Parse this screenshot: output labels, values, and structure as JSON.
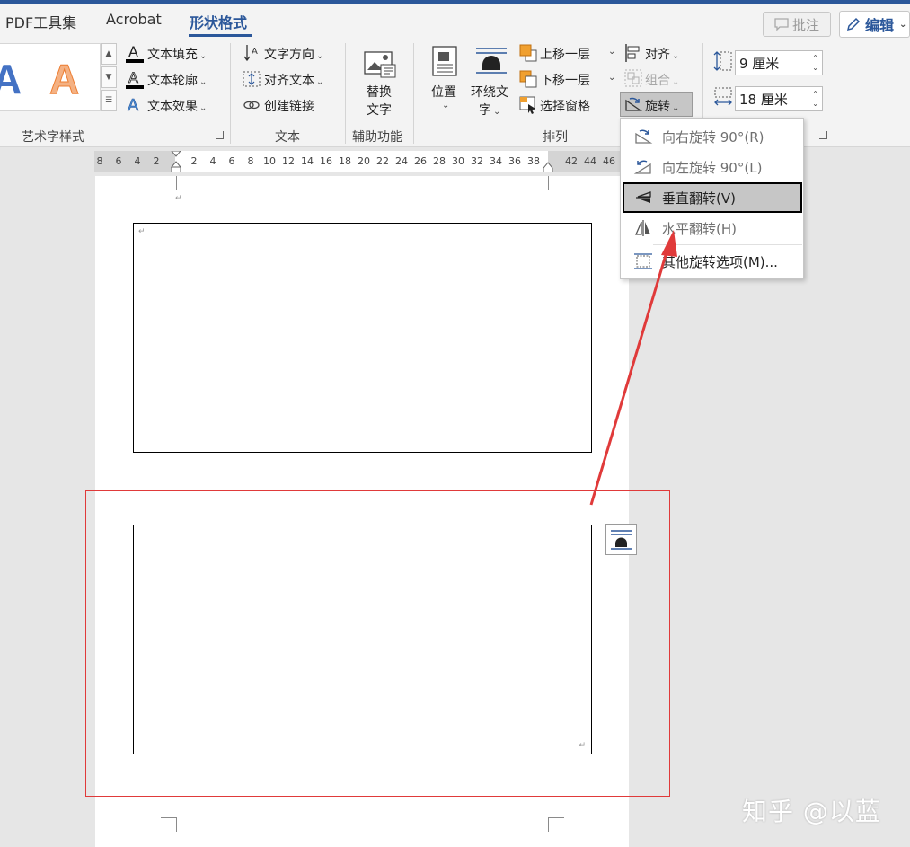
{
  "tabs": [
    {
      "label": "PDF工具集"
    },
    {
      "label": "Acrobat"
    },
    {
      "label": "形状格式",
      "active": true
    }
  ],
  "top_right": {
    "comment_label": "批注",
    "edit_label": "编辑"
  },
  "ribbon": {
    "wordart": {
      "samples": [
        "A",
        "A"
      ],
      "text_fill": "文本填充",
      "text_outline": "文本轮廓",
      "text_effects": "文本效果",
      "group_label": "艺术字样式"
    },
    "text": {
      "text_direction": "文字方向",
      "align_text": "对齐文本",
      "create_link": "创建链接",
      "group_label": "文本"
    },
    "accessibility": {
      "alt_text_line1": "替换",
      "alt_text_line2": "文字",
      "group_label": "辅助功能"
    },
    "arrange": {
      "position": "位置",
      "wrap_text_line1": "环绕文",
      "wrap_text_line2": "字",
      "bring_forward": "上移一层",
      "send_backward": "下移一层",
      "selection_pane": "选择窗格",
      "align": "对齐",
      "group": "组合",
      "rotate": "旋转",
      "group_label": "排列"
    },
    "size": {
      "height_value": "9 厘米",
      "width_value": "18 厘米"
    }
  },
  "ruler": {
    "left_numbers": [
      "8",
      "6",
      "4",
      "2"
    ],
    "numbers": [
      "2",
      "4",
      "6",
      "8",
      "10",
      "12",
      "14",
      "16",
      "18",
      "20",
      "22",
      "24",
      "26",
      "28",
      "30",
      "32",
      "34",
      "36",
      "38"
    ],
    "right_numbers": [
      "42",
      "44",
      "46"
    ]
  },
  "rotate_menu": {
    "items": [
      {
        "label": "向右旋转 90°(R)",
        "state": "disabled"
      },
      {
        "label": "向左旋转 90°(L)",
        "state": "disabled"
      },
      {
        "label": "垂直翻转(V)",
        "state": "highlighted"
      },
      {
        "label": "水平翻转(H)",
        "state": "disabled"
      },
      {
        "label": "其他旋转选项(M)...",
        "state": "normal"
      }
    ]
  },
  "document": {
    "paragraph_mark": "↵",
    "anchor_mark": "↵"
  },
  "colors": {
    "accent": "#2b579a",
    "annotation_red": "#e03a3a",
    "menu_highlight": "#c6c6c6"
  },
  "watermark": "知乎 @以蓝"
}
